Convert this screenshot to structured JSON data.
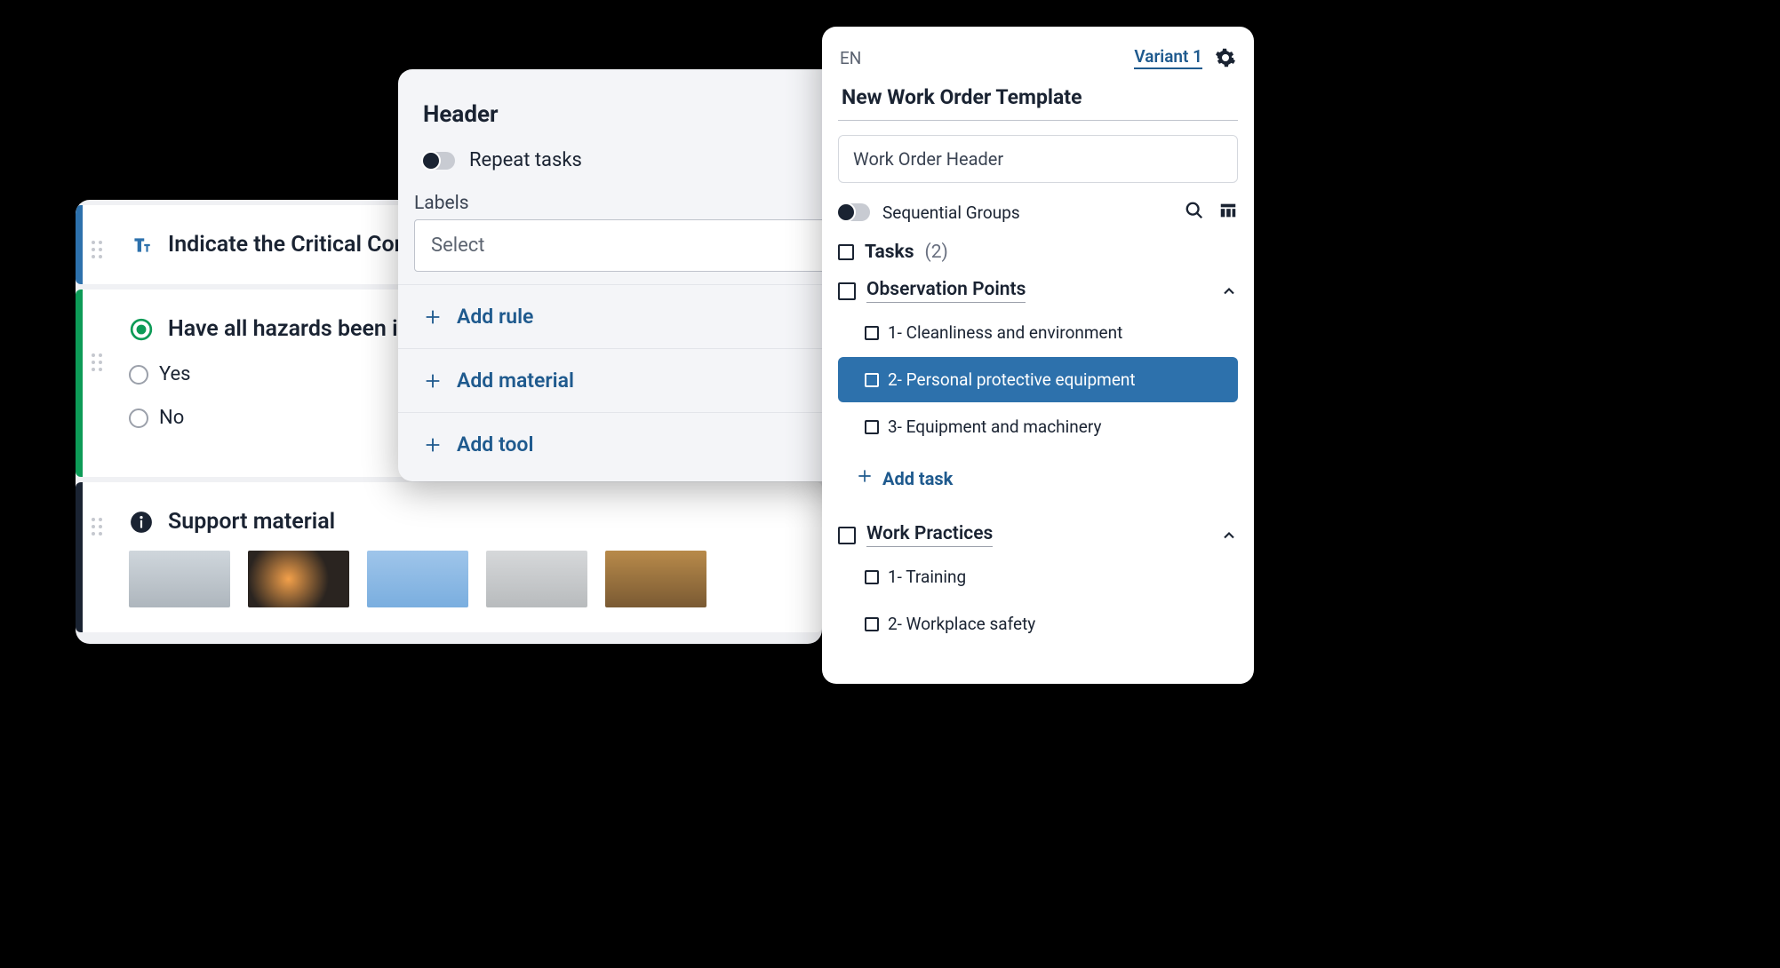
{
  "left": {
    "card1": {
      "title": "Indicate the Critical Contro"
    },
    "card2": {
      "title": "Have all hazards been ider",
      "optYes": "Yes",
      "optNo": "No"
    },
    "card3": {
      "title": "Support material"
    }
  },
  "mid": {
    "header": "Header",
    "repeat": "Repeat tasks",
    "labelsLabel": "Labels",
    "selectPlaceholder": "Select",
    "addRule": "Add rule",
    "addMaterial": "Add material",
    "addTool": "Add tool"
  },
  "right": {
    "lang": "EN",
    "variant": "Variant 1",
    "title": "New Work Order Template",
    "headerInput": "Work Order Header",
    "sequential": "Sequential Groups",
    "tasksLabel": "Tasks",
    "tasksCount": "(2)",
    "group1": {
      "title": "Observation Points",
      "t1": "1- Cleanliness and environment",
      "t2": "2- Personal protective equipment",
      "t3": "3- Equipment and machinery"
    },
    "addTask": "Add task",
    "group2": {
      "title": "Work Practices",
      "t1": "1- Training",
      "t2": "2- Workplace safety"
    }
  }
}
